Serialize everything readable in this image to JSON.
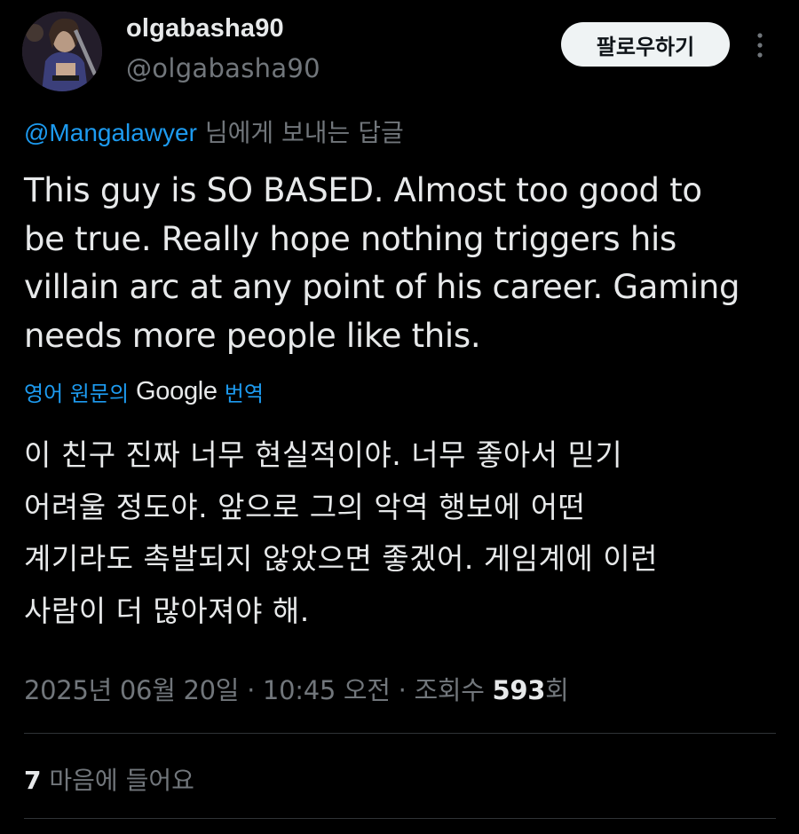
{
  "user": {
    "display_name": "olgabasha90",
    "handle": "@olgabasha90",
    "avatar_icon": "profile-avatar"
  },
  "header": {
    "follow_label": "팔로우하기",
    "more_icon": "more-vertical-icon"
  },
  "reply": {
    "mention": "@Mangalawyer",
    "suffix": " 님에게 보내는 답글"
  },
  "tweet": {
    "text": "This guy is SO BASED. Almost too good to\nbe true. Really hope nothing triggers his\nvillain arc at any point of his career. Gaming\nneeds more people like this."
  },
  "translation": {
    "prefix": "영어 원문의",
    "brand": "Google",
    "suffix": "번역",
    "text": "이 친구 진짜 너무 현실적이야. 너무 좋아서 믿기\n어려울 정도야. 앞으로 그의 악역 행보에 어떤\n계기라도 촉발되지 않았으면 좋겠어. 게임계에 이런\n사람이 더 많아져야 해."
  },
  "meta": {
    "timestamp": "2025년 06월 20일 · 10:45 오전 · ",
    "views_label": "조회수 ",
    "views_count": "593",
    "views_suffix": "회"
  },
  "engagement": {
    "likes_count": "7",
    "likes_label": " 마음에 들어요"
  },
  "colors": {
    "background": "#000000",
    "text_primary": "#e7e9ea",
    "text_secondary": "#71767b",
    "accent": "#1d9bf0",
    "button_bg": "#eff3f4",
    "divider": "#2f3336"
  }
}
